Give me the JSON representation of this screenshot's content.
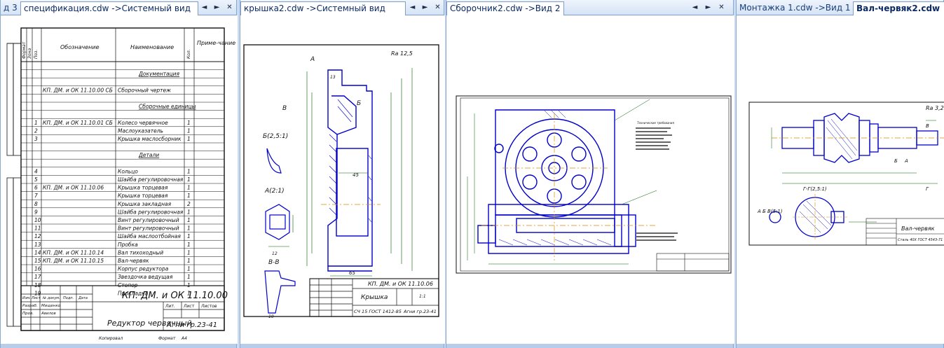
{
  "panes": [
    {
      "tab_prefix": "д 3",
      "tab_title": "спецификация.cdw ->Системный вид",
      "prev": "◄",
      "next": "►",
      "close": "✕"
    },
    {
      "tab_title": "крышка2.cdw ->Системный вид",
      "prev": "◄",
      "next": "►",
      "close": "✕"
    },
    {
      "tab_title": "Сборочник2.cdw ->Вид 2",
      "prev": "◄",
      "next": "►",
      "close": "✕"
    },
    {
      "tab_title": "Монтажка 1.cdw ->Вид 1",
      "tab_active": "Вал-червяк2.cdw"
    }
  ],
  "spec": {
    "headers": {
      "format": "Формат",
      "zone": "Зона",
      "pos": "Поз.",
      "designation": "Обозначение",
      "name": "Наименование",
      "qty": "Кол.",
      "note": "Приме-чание"
    },
    "rows": [
      {
        "pos": "",
        "des": "",
        "name": "",
        "qty": ""
      },
      {
        "pos": "",
        "des": "",
        "name": "Документация",
        "qty": ""
      },
      {
        "pos": "",
        "des": "",
        "name": "",
        "qty": ""
      },
      {
        "pos": "",
        "des": "КП. ДМ. и ОК 11.10.00 СБ",
        "name": "Сборочный чертеж",
        "qty": ""
      },
      {
        "pos": "",
        "des": "",
        "name": "",
        "qty": ""
      },
      {
        "pos": "",
        "des": "",
        "name": "Сборочные единицы",
        "qty": ""
      },
      {
        "pos": "",
        "des": "",
        "name": "",
        "qty": ""
      },
      {
        "pos": "1",
        "des": "КП. ДМ. и ОК 11.10.01 СБ",
        "name": "Колесо червячное",
        "qty": "1"
      },
      {
        "pos": "2",
        "des": "",
        "name": "Маслоуказатель",
        "qty": "1"
      },
      {
        "pos": "3",
        "des": "",
        "name": "Крышка маслосборник",
        "qty": "1"
      },
      {
        "pos": "",
        "des": "",
        "name": "",
        "qty": ""
      },
      {
        "pos": "",
        "des": "",
        "name": "Детали",
        "qty": ""
      },
      {
        "pos": "",
        "des": "",
        "name": "",
        "qty": ""
      },
      {
        "pos": "4",
        "des": "",
        "name": "Кольцо",
        "qty": "1"
      },
      {
        "pos": "5",
        "des": "",
        "name": "Шайба регулировочная",
        "qty": "1"
      },
      {
        "pos": "6",
        "des": "КП. ДМ. и ОК 11.10.06",
        "name": "Крышка торцевая",
        "qty": "1"
      },
      {
        "pos": "7",
        "des": "",
        "name": "Крышка торцевая",
        "qty": "1"
      },
      {
        "pos": "8",
        "des": "",
        "name": "Крышка закладная",
        "qty": "2"
      },
      {
        "pos": "9",
        "des": "",
        "name": "Шайба регулировочная",
        "qty": "1"
      },
      {
        "pos": "10",
        "des": "",
        "name": "Винт регулировочный",
        "qty": "1"
      },
      {
        "pos": "11",
        "des": "",
        "name": "Винт регулировочный",
        "qty": "1"
      },
      {
        "pos": "12",
        "des": "",
        "name": "Шайба маслоотбойная",
        "qty": "1"
      },
      {
        "pos": "13",
        "des": "",
        "name": "Пробка",
        "qty": "1"
      },
      {
        "pos": "14",
        "des": "КП. ДМ. и ОК 11.10.14",
        "name": "Вал тихоходный",
        "qty": "1"
      },
      {
        "pos": "15",
        "des": "КП. ДМ. и ОК 11.10.15",
        "name": "Вал-червяк",
        "qty": "1"
      },
      {
        "pos": "16",
        "des": "",
        "name": "Корпус редуктора",
        "qty": "1"
      },
      {
        "pos": "17",
        "des": "",
        "name": "Звездочка ведущая",
        "qty": "1"
      },
      {
        "pos": "18",
        "des": "",
        "name": "Стопор",
        "qty": "1"
      },
      {
        "pos": "19",
        "des": "",
        "name": "Прокладка",
        "qty": "1"
      }
    ],
    "stamp_code": "КП. ДМ. и ОК 11.10.00",
    "stamp_title": "Редуктор червячный",
    "stamp_group": "Агни гр.23-41",
    "stamp_headers": [
      "Лит.",
      "Лист",
      "Листов"
    ],
    "stamp_roles": [
      "Разраб.",
      "Пров."
    ],
    "stamp_names": [
      "Мищенко",
      "Авилов"
    ],
    "stamp_change_cols": [
      "Изм.",
      "Лист",
      "№ докум.",
      "Подп.",
      "Дата"
    ],
    "bottom_copy": "Копировал",
    "bottom_format": "Формат",
    "bottom_format_val": "А4"
  },
  "lid": {
    "roughness": "Ra 12,5",
    "callout_a": "А",
    "callout_b": "Б",
    "callout_v": "В",
    "view_b": "Б(2,5:1)",
    "view_a": "А(2:1)",
    "view_vv": "В-В",
    "dim_45": "45",
    "dim_12": "12",
    "dim_10": "10",
    "dim_65": "65",
    "dim_13": "13",
    "stamp_code": "КП. ДМ. и ОК 11.10.06",
    "stamp_title": "Крышка",
    "stamp_material": "СЧ 15 ГОСТ 1412-85",
    "stamp_group": "Агни гр.23-41",
    "stamp_scale": "1:1"
  },
  "assembly": {
    "notes_title": "Технические требования"
  },
  "shaft": {
    "roughness": "Ra 3,2",
    "section_ab": "А Б В(5:1)",
    "section_gg": "Г-Г(2,5:1)",
    "stamp_title": "Вал-червяк",
    "stamp_material": "Сталь 40Х ГОСТ 4543-71",
    "label_a": "А",
    "label_b": "Б",
    "label_v": "В",
    "label_g": "Г"
  },
  "colors": {
    "line": "#0000cc",
    "axis": "#d98a00",
    "dim": "#006000",
    "text": "#1a1a1a"
  }
}
